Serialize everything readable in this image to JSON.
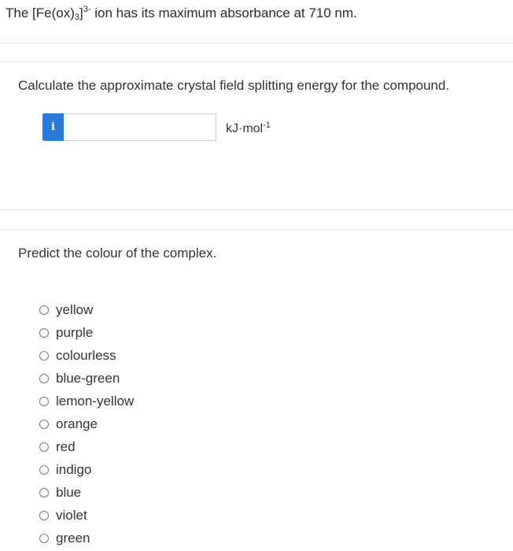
{
  "intro": {
    "prefix": "The [Fe(ox)",
    "subscript": "3",
    "bracket": "]",
    "superscript": "3-",
    "suffix": " ion has its maximum absorbance at 710 nm."
  },
  "question1": {
    "prompt": "Calculate the approximate crystal field splitting energy for the compound.",
    "info_icon_glyph": "i",
    "input_value": "",
    "unit_base": "kJ·mol",
    "unit_exponent": "-1"
  },
  "question2": {
    "prompt": "Predict the colour of the complex.",
    "options": [
      "yellow",
      "purple",
      "colourless",
      "blue-green",
      "lemon-yellow",
      "orange",
      "red",
      "indigo",
      "blue",
      "violet",
      "green"
    ]
  },
  "colors": {
    "info_button": "#2d7bd8",
    "divider": "#e3e3e3",
    "text": "#333333"
  }
}
